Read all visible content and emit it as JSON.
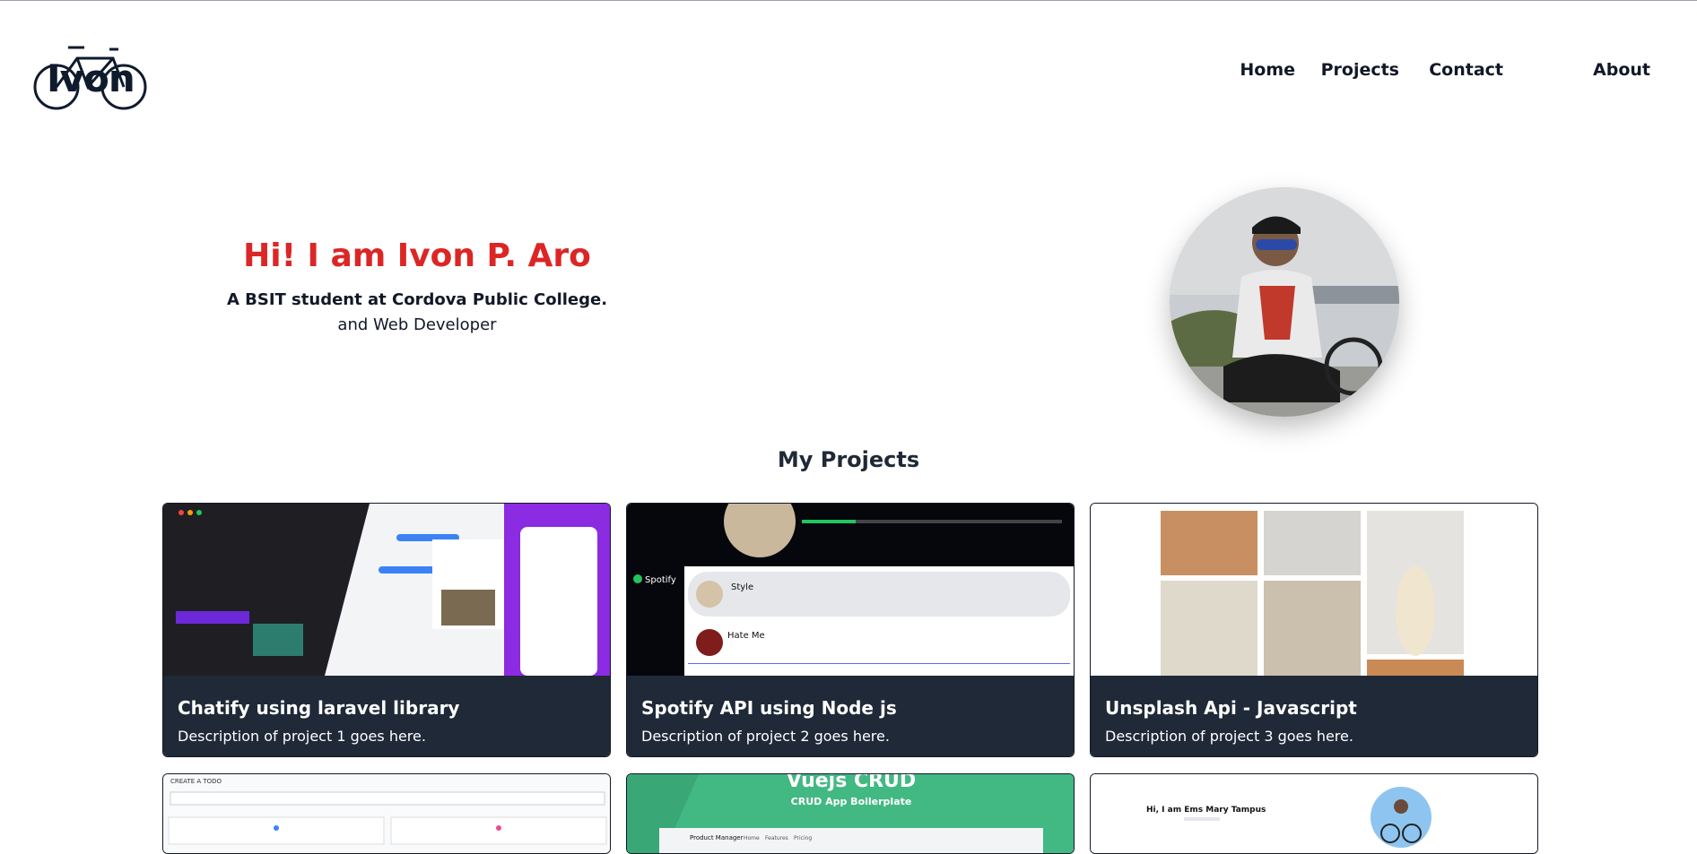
{
  "logo": {
    "text": "Ivon"
  },
  "nav": {
    "items": [
      "Home",
      "Projects",
      "Contact",
      "About"
    ]
  },
  "hero": {
    "title": "Hi! I am Ivon P. Aro",
    "subtitle": "A BSIT student at Cordova Public College.",
    "subtitle2": "and Web Developer"
  },
  "projects": {
    "heading": "My Projects",
    "cards": [
      {
        "title": "Chatify using laravel library",
        "description": "Description of project 1 goes here."
      },
      {
        "title": "Spotify API using Node js",
        "description": "Description of project 2 goes here."
      },
      {
        "title": "Unsplash Api - Javascript",
        "description": "Description of project 3 goes here."
      }
    ],
    "previews": {
      "p4": {
        "label": "CREATE A TODO"
      },
      "p5": {
        "title": "Vuejs CRUD",
        "subtitle": "CRUD App Boilerplate",
        "menu": [
          "Product Manager",
          "Home",
          "Features",
          "Pricing"
        ]
      },
      "p6": {
        "heading": "Hi, I am Ems Mary Tampus"
      }
    },
    "spotify_preview": {
      "songs": [
        "Style",
        "Hate Me"
      ],
      "brand": "Spotify"
    }
  },
  "colors": {
    "accent": "#dc2626",
    "card_body": "#1f2937",
    "text": "#111827"
  }
}
